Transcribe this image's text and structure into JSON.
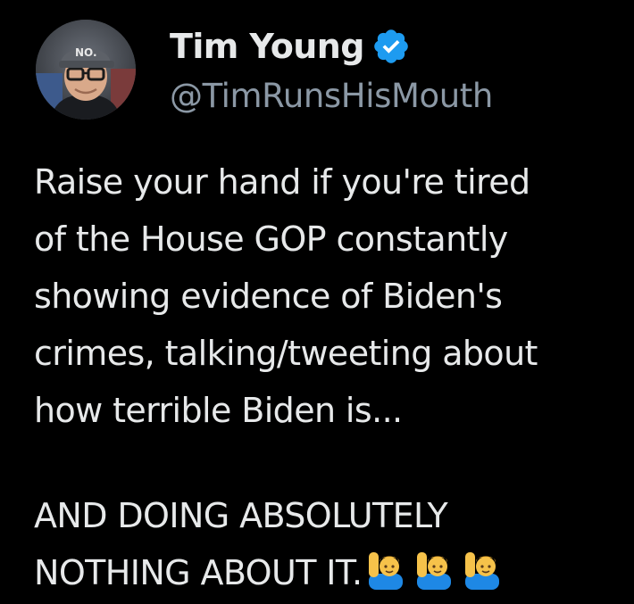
{
  "author": {
    "display_name": "Tim Young",
    "handle": "@TimRunsHisMouth",
    "verified": true,
    "avatar_icon": "profile-photo",
    "cap_text": "NO."
  },
  "tweet": {
    "paragraph_1_lines": [
      "Raise your hand if you're tired",
      "of the House GOP constantly",
      "showing evidence of Biden's",
      "crimes, talking/tweeting about",
      "how terrible Biden is..."
    ],
    "paragraph_2_lines": [
      "AND DOING ABSOLUTELY",
      "NOTHING ABOUT IT."
    ],
    "trailing_emoji": [
      "person-raising-hand-icon",
      "person-raising-hand-icon",
      "person-raising-hand-icon"
    ]
  },
  "colors": {
    "background": "#000000",
    "text": "#e7e9ea",
    "handle": "#8b98a5",
    "verified_blue": "#1d9bf0"
  }
}
